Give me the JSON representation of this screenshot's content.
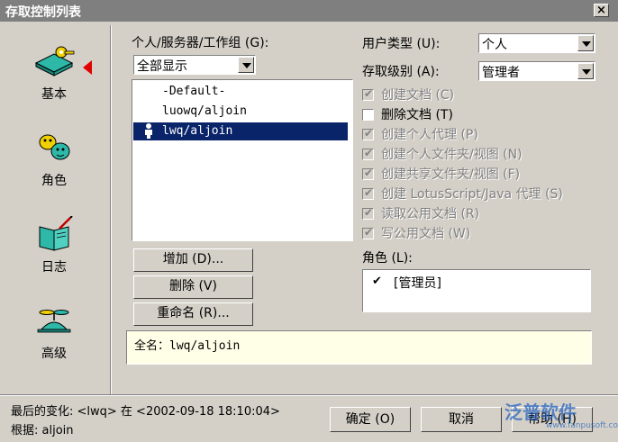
{
  "window": {
    "title": "存取控制列表",
    "close_label": "×"
  },
  "nav": {
    "items": [
      {
        "label": "基本",
        "icon": "keys-icon",
        "selected": true
      },
      {
        "label": "角色",
        "icon": "roles-icon",
        "selected": false
      },
      {
        "label": "日志",
        "icon": "log-book-icon",
        "selected": false
      },
      {
        "label": "高级",
        "icon": "propeller-hat-icon",
        "selected": false
      }
    ]
  },
  "people": {
    "label": "个人/服务器/工作组 (G):",
    "filter_value": "全部显示",
    "list": [
      "-Default-",
      "luowq/aljoin",
      "lwq/aljoin"
    ],
    "selected_index": 2
  },
  "user_type": {
    "label": "用户类型 (U):",
    "value": "个人"
  },
  "access_level": {
    "label": "存取级别 (A):",
    "value": "管理者"
  },
  "permissions": [
    {
      "label": "创建文档 (C)",
      "checked": true,
      "enabled": false
    },
    {
      "label": "删除文档 (T)",
      "checked": false,
      "enabled": true
    },
    {
      "label": "创建个人代理 (P)",
      "checked": true,
      "enabled": false
    },
    {
      "label": "创建个人文件夹/视图 (N)",
      "checked": true,
      "enabled": false
    },
    {
      "label": "创建共享文件夹/视图 (F)",
      "checked": true,
      "enabled": false
    },
    {
      "label": "创建 LotusScript/Java 代理 (S)",
      "checked": true,
      "enabled": false
    },
    {
      "label": "读取公用文档 (R)",
      "checked": true,
      "enabled": false
    },
    {
      "label": "写公用文档 (W)",
      "checked": true,
      "enabled": false
    }
  ],
  "roles": {
    "label": "角色 (L):",
    "items": [
      {
        "check": "✔",
        "name": "[管理员]"
      }
    ]
  },
  "buttons": {
    "add": "增加 (D)...",
    "remove": "删除 (V)",
    "rename": "重命名 (R)..."
  },
  "full_name": "全名：lwq/aljoin",
  "status": {
    "last_change": "最后的变化: <lwq> 在 <2002-09-18 18:10:04>",
    "based_on": "根据: aljoin"
  },
  "footer": {
    "ok": "确定 (O)",
    "cancel": "取消",
    "help": "帮助 (H)"
  },
  "watermark": {
    "text": "泛普软件",
    "url": "www.fanpusoft.com"
  }
}
